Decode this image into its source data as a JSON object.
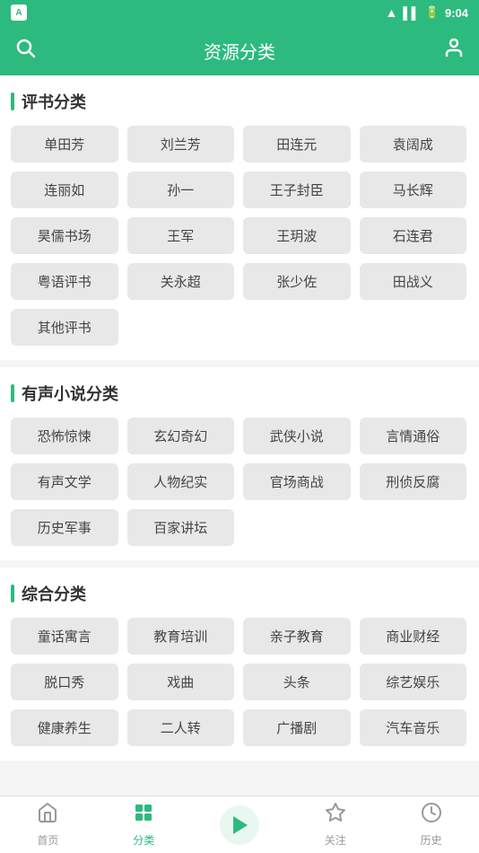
{
  "statusBar": {
    "time": "9:04",
    "appLabel": "A"
  },
  "header": {
    "title": "资源分类",
    "searchIcon": "search-icon",
    "userIcon": "user-icon"
  },
  "sections": [
    {
      "id": "pingping",
      "title": "评书分类",
      "tags": [
        "单田芳",
        "刘兰芳",
        "田连元",
        "袁阔成",
        "连丽如",
        "孙一",
        "王子封臣",
        "马长辉",
        "昊儒书场",
        "王军",
        "王玥波",
        "石连君",
        "粤语评书",
        "关永超",
        "张少佐",
        "田战义",
        "其他评书"
      ]
    },
    {
      "id": "audionovel",
      "title": "有声小说分类",
      "tags": [
        "恐怖惊悚",
        "玄幻奇幻",
        "武侠小说",
        "言情通俗",
        "有声文学",
        "人物纪实",
        "官场商战",
        "刑侦反腐",
        "历史军事",
        "百家讲坛"
      ]
    },
    {
      "id": "integrated",
      "title": "综合分类",
      "tags": [
        "童话寓言",
        "教育培训",
        "亲子教育",
        "商业财经",
        "脱口秀",
        "戏曲",
        "头条",
        "综艺娱乐",
        "健康养生",
        "二人转",
        "广播剧",
        "汽车音乐"
      ]
    }
  ],
  "bottomNav": [
    {
      "id": "home",
      "label": "首页",
      "icon": "home",
      "active": false
    },
    {
      "id": "category",
      "label": "分类",
      "icon": "grid",
      "active": true
    },
    {
      "id": "play",
      "label": "",
      "icon": "play",
      "active": false
    },
    {
      "id": "follow",
      "label": "关注",
      "icon": "star",
      "active": false
    },
    {
      "id": "history",
      "label": "历史",
      "icon": "clock",
      "active": false
    }
  ]
}
